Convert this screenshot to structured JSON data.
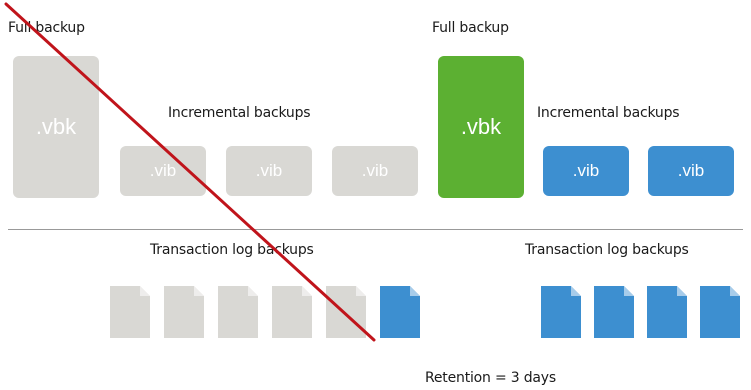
{
  "old_chain": {
    "full_label": "Full backup",
    "full_ext": ".vbk",
    "incremental_label": "Incremental backups",
    "incremental_ext": [
      ".vib",
      ".vib",
      ".vib"
    ],
    "log_label": "Transaction log backups",
    "log_file_count": 6
  },
  "new_chain": {
    "full_label": "Full backup",
    "full_ext": ".vbk",
    "incremental_label": "Incremental backups",
    "incremental_ext": [
      ".vib",
      ".vib"
    ],
    "log_label": "Transaction log backups",
    "log_file_count": 4
  },
  "retention_label": "Retention = 3 days",
  "colors": {
    "expired": "#d9d8d4",
    "full_active": "#5cb032",
    "active": "#3d8fd0",
    "strike": "#c0141b"
  }
}
